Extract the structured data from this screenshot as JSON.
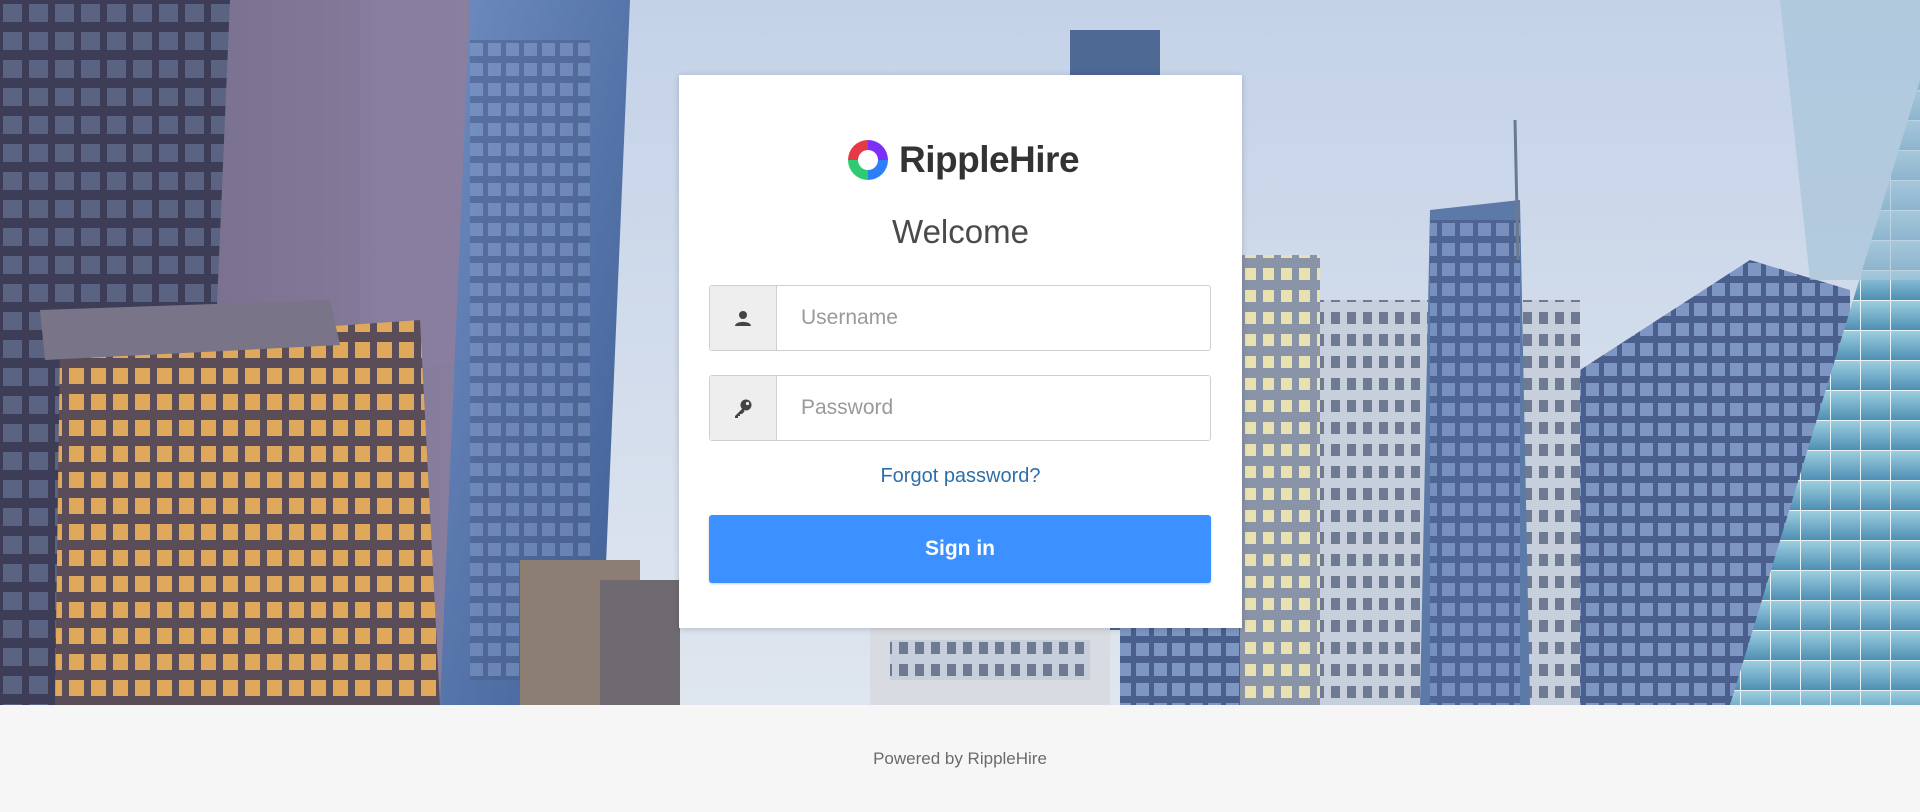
{
  "brand": {
    "name": "RippleHire",
    "logo_icon": "ripplehire-logo-icon",
    "logo_colors": [
      "#e63946",
      "#7b2ff7",
      "#2d7ff9",
      "#2ecc71"
    ]
  },
  "login": {
    "heading": "Welcome",
    "username": {
      "placeholder": "Username",
      "value": "",
      "icon": "user-icon"
    },
    "password": {
      "placeholder": "Password",
      "value": "",
      "icon": "key-icon"
    },
    "forgot_link": "Forgot password?",
    "submit_label": "Sign in"
  },
  "footer": {
    "text": "Powered by RippleHire"
  },
  "colors": {
    "primary_button": "#3d90ff",
    "link": "#2f6fa8",
    "footer_bg": "#f6f6f7"
  }
}
